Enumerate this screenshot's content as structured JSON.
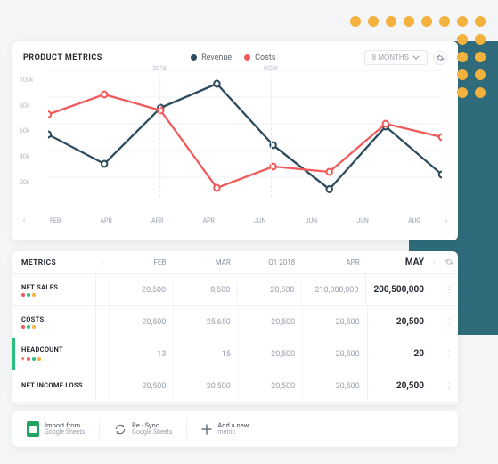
{
  "colors": {
    "revenue": "#2d4b5e",
    "costs": "#f15a5a",
    "accent": "#2bbf7e"
  },
  "chart": {
    "title": "PRODUCT METRICS",
    "legend": {
      "a": "Revenue",
      "b": "Costs"
    },
    "period": "8 MONTHS",
    "yticks": [
      "100k",
      "80k",
      "60k",
      "40k",
      "20k"
    ],
    "xlabels": [
      "FEB",
      "APR",
      "APR",
      "APR",
      "JUN",
      "JUN",
      "JUN",
      "AUG"
    ],
    "marker_a": "2018",
    "marker_b": "NOW"
  },
  "chart_data": {
    "type": "line",
    "x": [
      "FEB",
      "APR",
      "APR",
      "APR",
      "JUN",
      "JUN",
      "JUN",
      "AUG"
    ],
    "series": [
      {
        "name": "Revenue",
        "color": "#2d4b5e",
        "values": [
          52,
          30,
          72,
          90,
          44,
          11,
          58,
          22
        ]
      },
      {
        "name": "Costs",
        "color": "#f15a5a",
        "values": [
          67,
          82,
          70,
          12,
          28,
          24,
          60,
          50
        ]
      }
    ],
    "ylim": [
      0,
      100
    ],
    "yticks": [
      20,
      40,
      60,
      80,
      100
    ],
    "markers": [
      {
        "label": "2018",
        "x_index": 2
      },
      {
        "label": "NOW",
        "x_index": 4
      }
    ]
  },
  "table": {
    "title": "METRICS",
    "cols": [
      "FEB",
      "MAR",
      "Q1 2018",
      "APR",
      "MAY"
    ],
    "rows": [
      {
        "name": "NET SALES",
        "dots": [
          "#f15a5a",
          "#2bbf7e",
          "#f3b13e"
        ],
        "trend": "none",
        "vals": [
          "20,500",
          "8,500",
          "20,500",
          "210,000,000",
          "200,500,000"
        ]
      },
      {
        "name": "COSTS",
        "dots": [
          "#f15a5a",
          "#2bbf7e",
          "#f3b13e"
        ],
        "trend": "none",
        "vals": [
          "20,500",
          "25,650",
          "20,500",
          "20,500",
          "20,500"
        ]
      },
      {
        "name": "HEADCOUNT",
        "dots": [
          "#f15a5a",
          "#2bbf7e",
          "#f3b13e"
        ],
        "trend": "down",
        "vals": [
          "13",
          "15",
          "20,500",
          "20,500",
          "20"
        ]
      },
      {
        "name": "NET INCOME LOSS",
        "dots": [],
        "trend": "none",
        "vals": [
          "20,500",
          "20,500",
          "20,500",
          "20,500",
          "20,500"
        ]
      }
    ]
  },
  "footer": {
    "import": {
      "l1": "Import from",
      "l2": "Google Sheets"
    },
    "resync": {
      "l1": "Re - Sync",
      "l2": "Google Sheets"
    },
    "add": {
      "l1": "Add a new",
      "l2": "metric"
    }
  }
}
